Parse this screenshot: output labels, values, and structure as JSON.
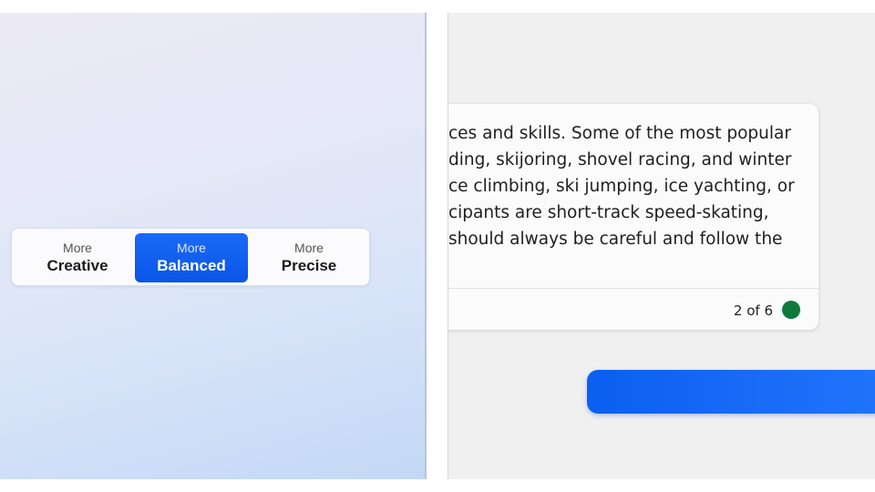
{
  "tone_selector": {
    "options": [
      {
        "prefix": "More",
        "label": "Creative",
        "selected": false
      },
      {
        "prefix": "More",
        "label": "Balanced",
        "selected": true
      },
      {
        "prefix": "More",
        "label": "Precise",
        "selected": false
      }
    ]
  },
  "response": {
    "lines": [
      "ces and skills. Some of the most popular",
      "ding, skijoring, shovel racing, and winter",
      "ce climbing, ski jumping, ice yachting, or",
      "cipants are short-track speed-skating,",
      "should always be careful and follow the"
    ],
    "counter": "2 of 6"
  },
  "colors": {
    "accent": "#0a55e6",
    "status_dot": "#0e7a3a"
  }
}
